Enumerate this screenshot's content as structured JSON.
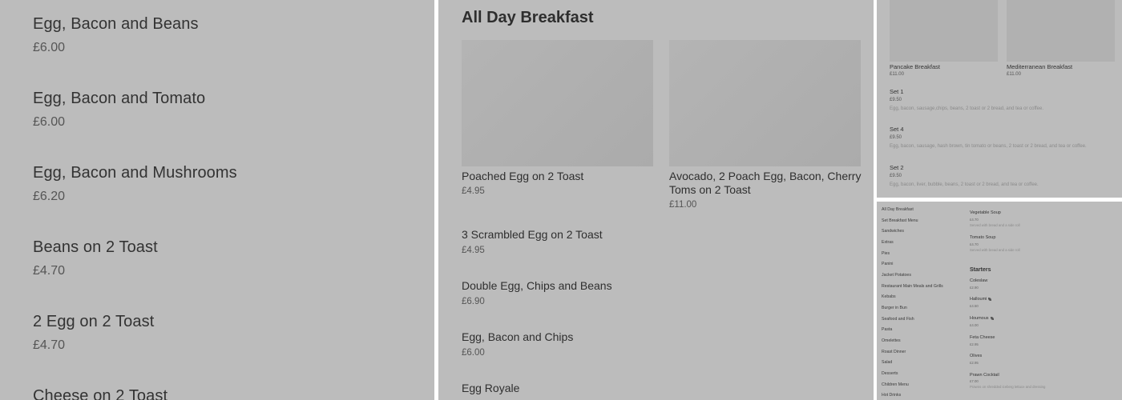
{
  "left_panel": {
    "items": [
      {
        "name": "Egg, Bacon and Beans",
        "price": "£6.00"
      },
      {
        "name": "Egg, Bacon and Tomato",
        "price": "£6.00"
      },
      {
        "name": "Egg, Bacon and Mushrooms",
        "price": "£6.20"
      },
      {
        "name": "Beans on 2 Toast",
        "price": "£4.70"
      },
      {
        "name": "2 Egg on 2 Toast",
        "price": "£4.70"
      },
      {
        "name": "Cheese on 2 Toast",
        "price": ""
      }
    ]
  },
  "middle_panel": {
    "section_title": "All Day Breakfast",
    "featured": [
      {
        "name": "Poached Egg on 2 Toast",
        "price": "£4.95"
      },
      {
        "name": "Avocado, 2 Poach Egg, Bacon, Cherry Toms on 2 Toast",
        "price": "£11.00"
      }
    ],
    "items": [
      {
        "name": "3 Scrambled Egg on 2 Toast",
        "price": "£4.95"
      },
      {
        "name": "Double Egg, Chips and Beans",
        "price": "£6.90"
      },
      {
        "name": "Egg, Bacon and Chips",
        "price": "£6.00"
      },
      {
        "name": "Egg Royale",
        "price": ""
      }
    ]
  },
  "top_right_panel": {
    "featured": [
      {
        "name": "Pancake Breakfast",
        "price": "£11.00"
      },
      {
        "name": "Mediterranean Breakfast",
        "price": "£11.00"
      }
    ],
    "sets": [
      {
        "name": "Set 1",
        "price": "£9.50",
        "desc": "Egg, bacon, sausage,chips, beans, 2 toast or 2 bread, and tea or coffee."
      },
      {
        "name": "Set 4",
        "price": "£9.50",
        "desc": "Egg, bacon, sausage, hash brown, tin tomato or beans, 2 toast or 2 bread, and tea or coffee."
      },
      {
        "name": "Set 2",
        "price": "£9.50",
        "desc": "Egg, bacon, liver, bubble, beans, 2 toast or 2 bread, and tea or coffee."
      }
    ]
  },
  "bottom_right_panel": {
    "nav": [
      "All Day Breakfast",
      "Set Breakfast Menu",
      "Sandwiches",
      "Extras",
      "Pies",
      "Panini",
      "Jacket Potatoes",
      "Restaurant Main Meals and Grills",
      "Kebabs",
      "Burger in Bun",
      "Seafood and Fish",
      "Pasta",
      "Omelettes",
      "Roast Dinner",
      "Salad",
      "Desserts",
      "Children Menu",
      "Hot Drinks"
    ],
    "soups": [
      {
        "name": "Vegetable Soup",
        "price": "£4.70",
        "desc": "Served with bread and a side roll"
      },
      {
        "name": "Tomato Soup",
        "price": "£4.70",
        "desc": "Served with bread and a side roll"
      }
    ],
    "starters_heading": "Starters",
    "starters": [
      {
        "name": "Coleslaw",
        "price": "£2.90",
        "veg": false,
        "desc": ""
      },
      {
        "name": "Halloumi",
        "price": "£4.50",
        "veg": true,
        "desc": ""
      },
      {
        "name": "Houmous",
        "price": "£4.00",
        "veg": true,
        "desc": ""
      },
      {
        "name": "Feta Cheese",
        "price": "£2.95",
        "veg": false,
        "desc": ""
      },
      {
        "name": "Olives",
        "price": "£2.95",
        "veg": false,
        "desc": ""
      },
      {
        "name": "Prawn Cocktail",
        "price": "£7.00",
        "veg": false,
        "desc": "Prawns on shredded iceberg lettuce and dressing"
      }
    ]
  }
}
